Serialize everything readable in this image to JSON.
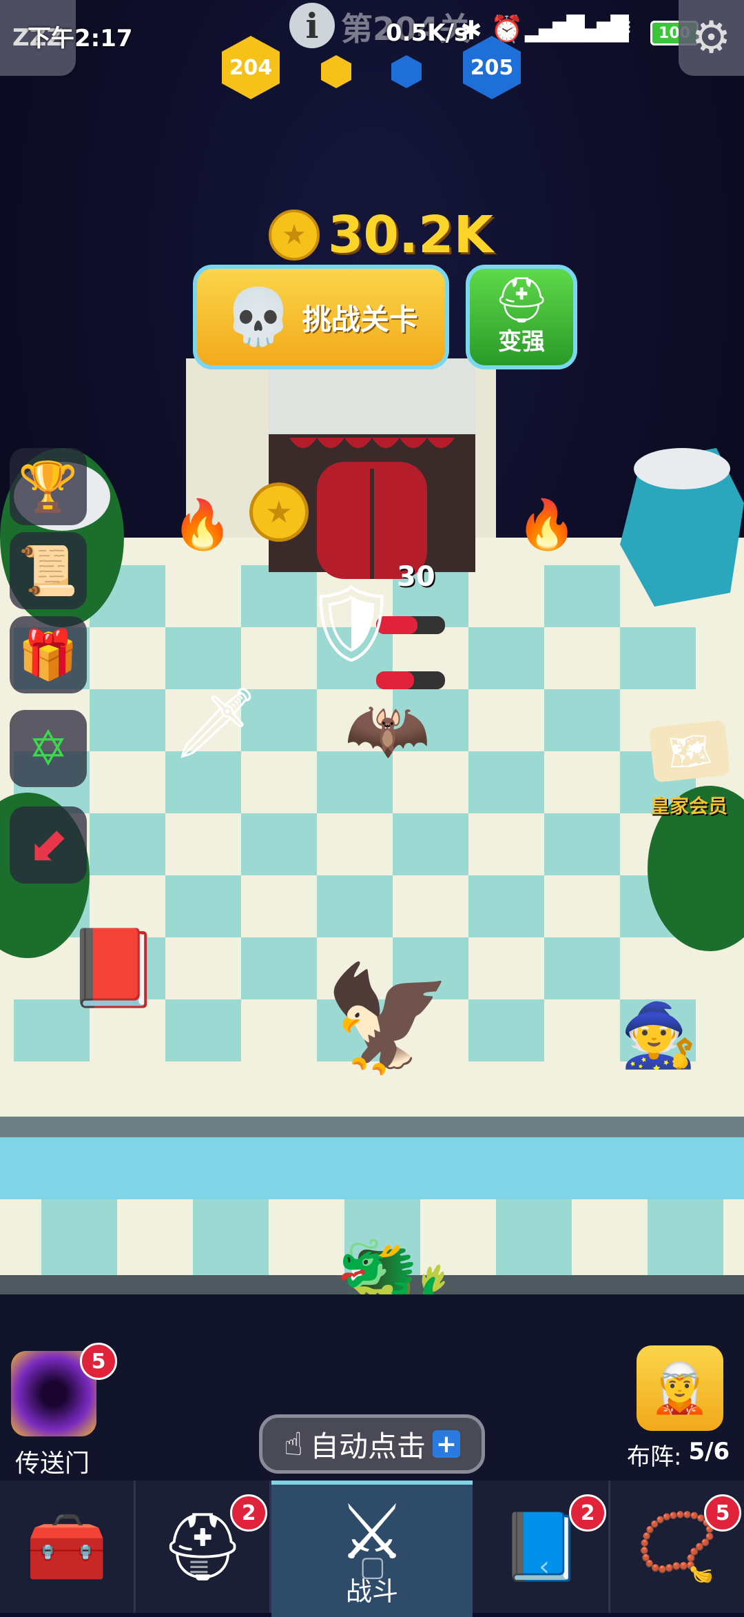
{
  "status_bar": {
    "time": "下午2:17",
    "level_overlay": "第204关",
    "speed": "0.5K/s",
    "battery": "100",
    "sleep_label": "ZZZ"
  },
  "progress": {
    "current_level": "204",
    "next_level": "205"
  },
  "coins": {
    "amount": "30.2K"
  },
  "actions": {
    "challenge_label": "挑战关卡",
    "upgrade_label": "变强"
  },
  "battle": {
    "damage_number": "30",
    "royal_member_label": "皇家会员"
  },
  "portal": {
    "label": "传送门",
    "badge": "5"
  },
  "auto_click": {
    "label": "自动点击"
  },
  "formation": {
    "label": "布阵:",
    "count": "5/6"
  },
  "bottom_nav": {
    "battle_label": "战斗",
    "heroes_badge": "2",
    "book_badge": "2",
    "amulet_badge": "5"
  },
  "colors": {
    "gold": "#f6c21a",
    "green": "#3cb83a",
    "tile_light": "#f2f0df",
    "tile_teal": "#9dd9d3",
    "badge_red": "#e0223a"
  }
}
